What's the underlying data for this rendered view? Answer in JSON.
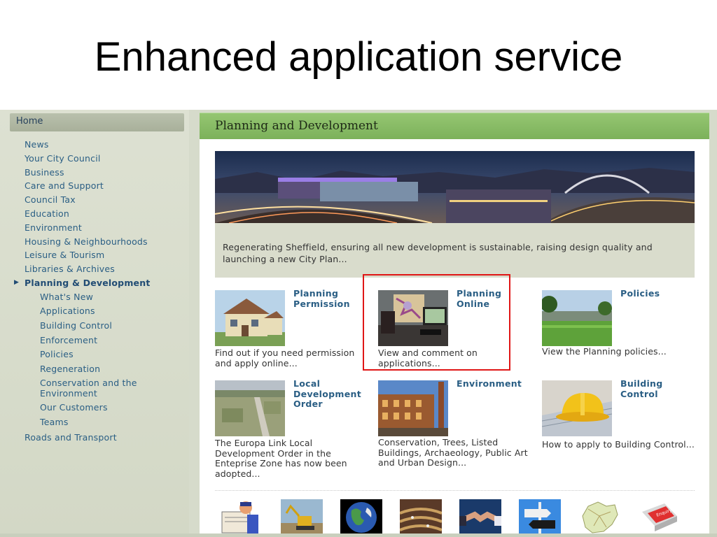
{
  "slide": {
    "title": "Enhanced application service"
  },
  "sidebar": {
    "home_label": "Home",
    "items": [
      "News",
      "Your City Council",
      "Business",
      "Care and Support",
      "Council Tax",
      "Education",
      "Environment",
      "Housing & Neighbourhoods",
      "Leisure & Tourism",
      "Libraries & Archives"
    ],
    "active_item": "Planning & Development",
    "subitems": [
      "What's New",
      "Applications",
      "Building Control",
      "Enforcement",
      "Policies",
      "Regeneration",
      "Conservation and the Environment",
      "Our Customers",
      "Teams"
    ],
    "after_items": [
      "Roads and Transport"
    ]
  },
  "main": {
    "heading": "Planning and Development",
    "intro": "Regenerating Sheffield, ensuring all new development is sustainable, raising design quality and launching a new City Plan...",
    "cards": [
      {
        "title": "Planning Permission",
        "desc": "Find out if you need permission and apply online...",
        "icon": "house-photo"
      },
      {
        "title": "Planning Online",
        "desc": "View and comment on applications...",
        "icon": "map-desk-photo"
      },
      {
        "title": "Policies",
        "desc": "View the Planning policies...",
        "icon": "park-photo"
      },
      {
        "title": "Local Development Order",
        "desc": "The Europa Link Local Development Order in the Enteprise Zone has now been adopted...",
        "icon": "aerial-photo"
      },
      {
        "title": "Environment",
        "desc": "Conservation, Trees, Listed Buildings, Archaeology, Public Art and Urban Design...",
        "icon": "heritage-building-photo"
      },
      {
        "title": "Building Control",
        "desc": "How to apply to Building Control...",
        "icon": "hardhat-photo"
      }
    ],
    "bottom_icons": [
      "newspaper-reader-icon",
      "digger-icon",
      "globe-icon",
      "council-chamber-icon",
      "handshake-icon",
      "signpost-icon",
      "city-map-icon",
      "enquiry-key-icon"
    ],
    "bottom_key_label": "Enquiry"
  },
  "colors": {
    "banner_green": "#86bb63",
    "link_blue": "#2a5e84",
    "sidebar_bg": "#d6dbcb",
    "highlight_red": "#e01616"
  }
}
